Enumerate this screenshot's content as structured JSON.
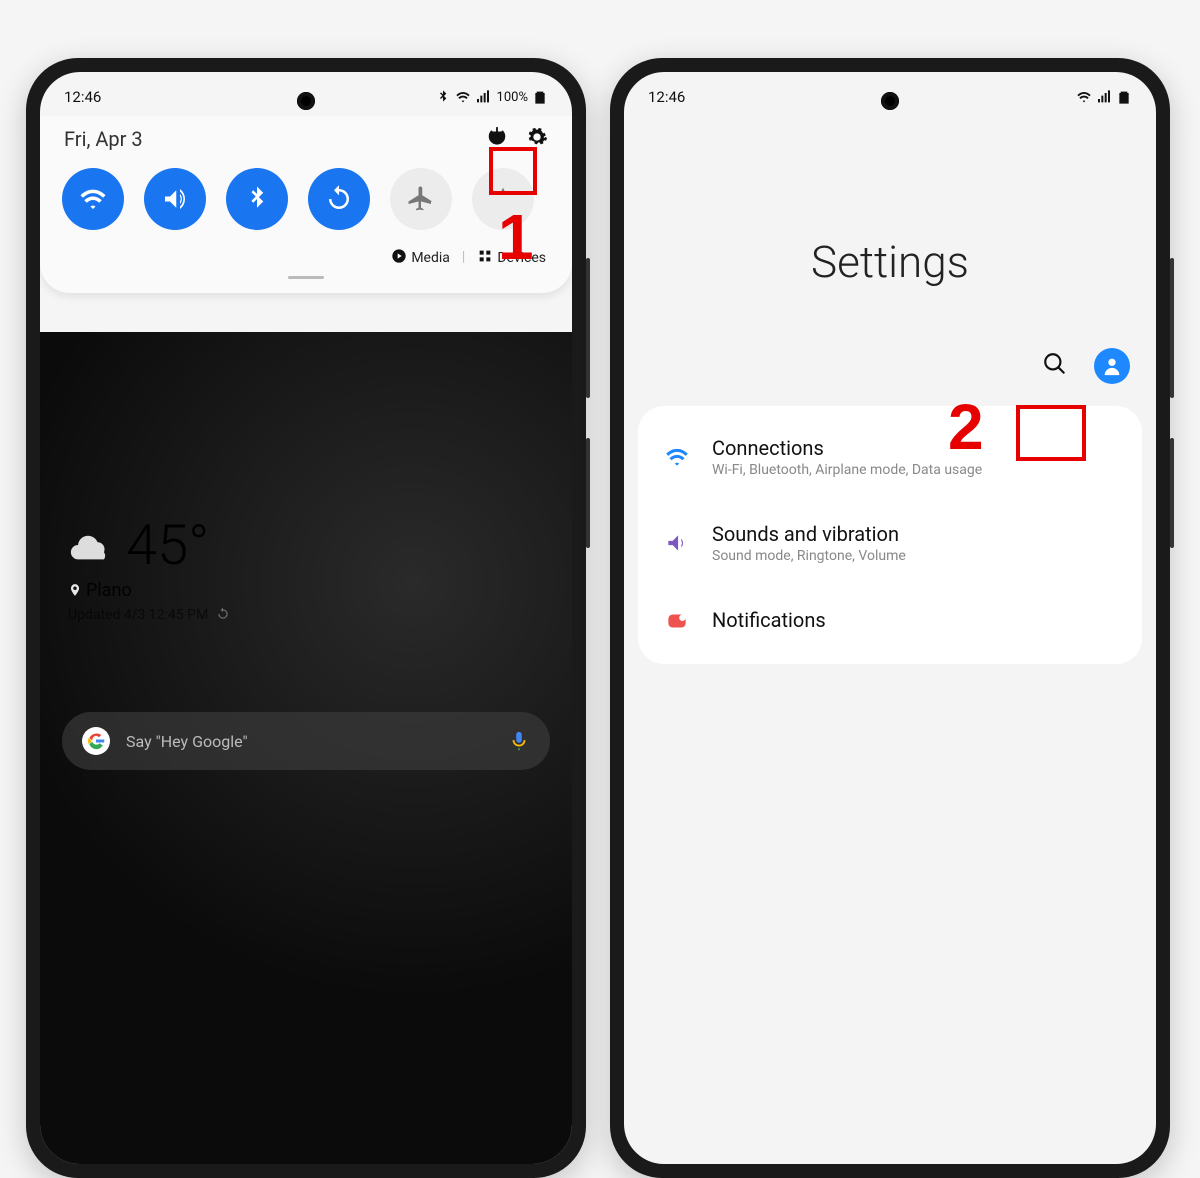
{
  "left": {
    "time": "12:46",
    "battery": "100%",
    "date": "Fri, Apr 3",
    "media_label": "Media",
    "devices_label": "Devices",
    "weather": {
      "temp": "45°",
      "location": "Plano",
      "updated": "Updated 4/3 12:45 PM"
    },
    "gsearch_hint": "Say \"Hey Google\""
  },
  "right": {
    "time": "12:46",
    "title": "Settings",
    "items": [
      {
        "title": "Connections",
        "subtitle": "Wi-Fi, Bluetooth, Airplane mode, Data usage"
      },
      {
        "title": "Sounds and vibration",
        "subtitle": "Sound mode, Ringtone, Volume"
      },
      {
        "title": "Notifications",
        "subtitle": ""
      }
    ]
  },
  "annotations": {
    "step1": "1",
    "step2": "2"
  }
}
